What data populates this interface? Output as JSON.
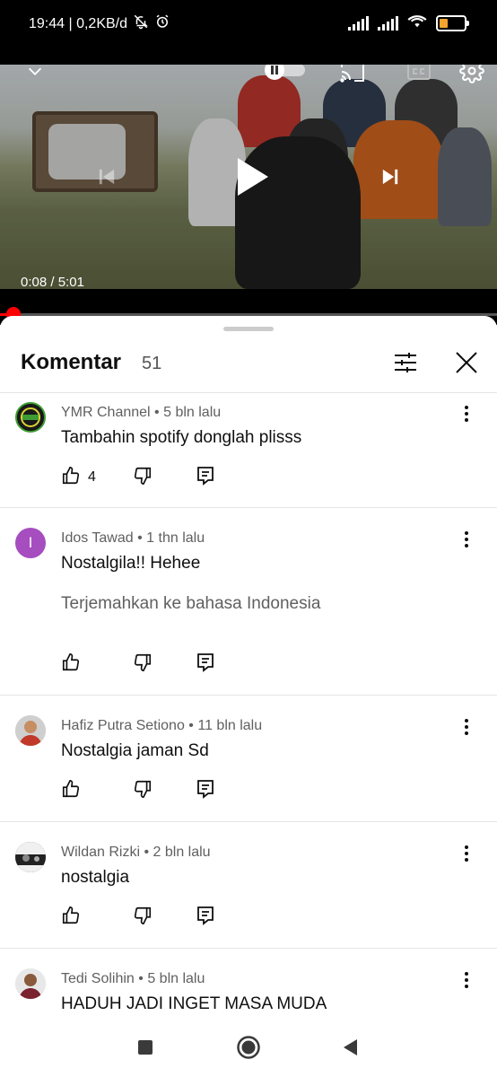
{
  "status_bar": {
    "time_speed": "19:44 | 0,2KB/d",
    "battery_color": "#f2a42e"
  },
  "player": {
    "current_time": "0:08",
    "duration": "5:01",
    "time_separator": " / ",
    "progress_fraction": 0.027,
    "accent": "#ff0000",
    "icons": [
      "chevron-down-icon",
      "pause-toggle-icon",
      "cast-icon",
      "captions-icon",
      "settings-icon",
      "skip-previous-icon",
      "play-icon",
      "skip-next-icon"
    ]
  },
  "comments_panel": {
    "title": "Komentar",
    "count": "51",
    "icons": [
      "filter-sort-icon",
      "close-icon"
    ]
  },
  "comments": [
    {
      "author": "YMR Channel",
      "age": "5 bln lalu",
      "text": "Tambahin spotify donglah plisss",
      "likes": "4",
      "translate": ""
    },
    {
      "author": "Idos Tawad",
      "age": "1 thn lalu",
      "text": "Nostalgila!! Hehee",
      "likes": "",
      "translate": "Terjemahkan ke bahasa Indonesia",
      "avatar_letter": "I",
      "avatar_color": "#a64dc0"
    },
    {
      "author": "Hafiz Putra Setiono",
      "age": "11 bln lalu",
      "text": "Nostalgia jaman Sd",
      "likes": "",
      "translate": ""
    },
    {
      "author": "Wildan Rizki",
      "age": "2 bln lalu",
      "text": "nostalgia",
      "likes": "",
      "translate": ""
    },
    {
      "author": "Tedi Solihin",
      "age": "5 bln lalu",
      "text": "HADUH JADI INGET MASA MUDA",
      "likes": "",
      "translate": ""
    }
  ],
  "meta_separator": " • ",
  "nav_bar": {
    "icons": [
      "recents-square-icon",
      "home-circle-icon",
      "back-triangle-icon"
    ]
  }
}
